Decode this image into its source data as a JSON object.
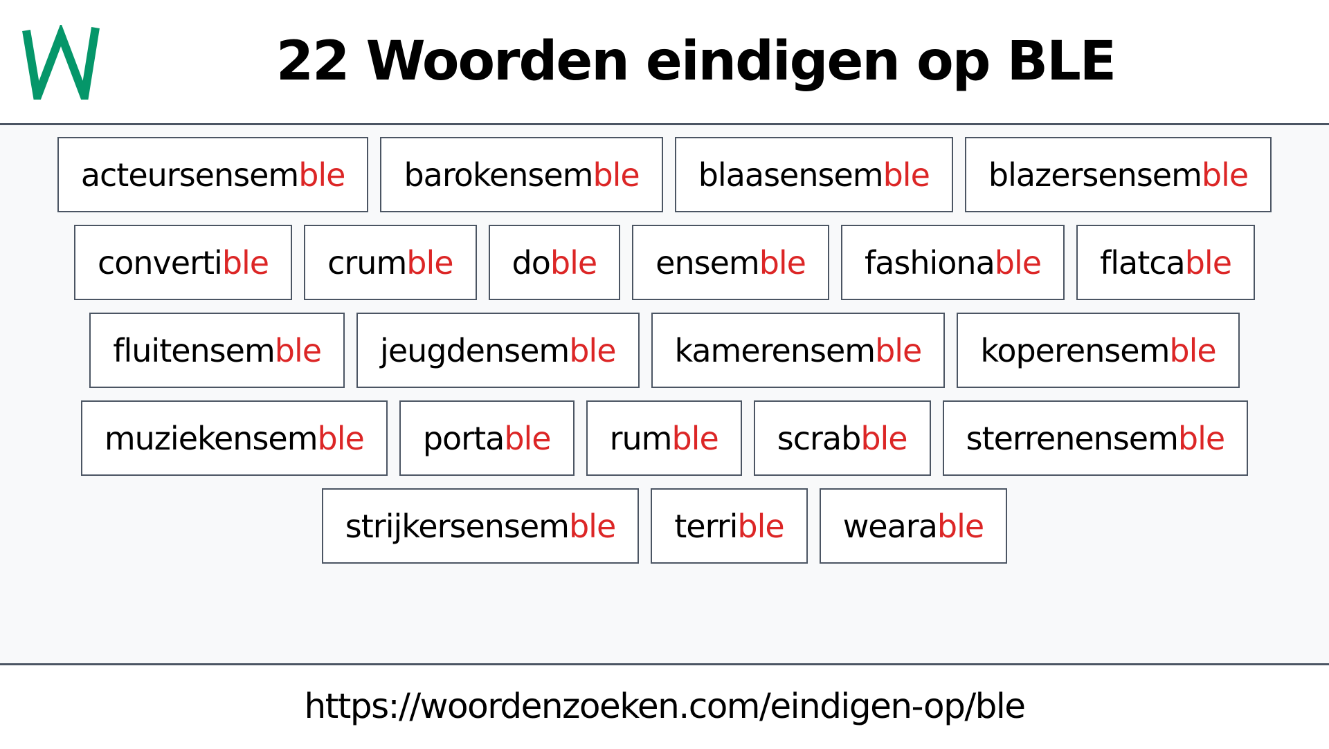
{
  "header": {
    "logo_letter": "W",
    "logo_color": "#059669",
    "title": "22 Woorden eindigen op BLE"
  },
  "suffix_color": "#dc2626",
  "rows": [
    [
      {
        "prefix": "acteursensem",
        "suffix": "ble"
      },
      {
        "prefix": "barokensem",
        "suffix": "ble"
      },
      {
        "prefix": "blaasensem",
        "suffix": "ble"
      },
      {
        "prefix": "blazersensem",
        "suffix": "ble"
      }
    ],
    [
      {
        "prefix": "converti",
        "suffix": "ble"
      },
      {
        "prefix": "crum",
        "suffix": "ble"
      },
      {
        "prefix": "do",
        "suffix": "ble"
      },
      {
        "prefix": "ensem",
        "suffix": "ble"
      },
      {
        "prefix": "fashiona",
        "suffix": "ble"
      },
      {
        "prefix": "flatca",
        "suffix": "ble"
      }
    ],
    [
      {
        "prefix": "fluitensem",
        "suffix": "ble"
      },
      {
        "prefix": "jeugdensem",
        "suffix": "ble"
      },
      {
        "prefix": "kamerensem",
        "suffix": "ble"
      },
      {
        "prefix": "koperensem",
        "suffix": "ble"
      }
    ],
    [
      {
        "prefix": "muziekensem",
        "suffix": "ble"
      },
      {
        "prefix": "porta",
        "suffix": "ble"
      },
      {
        "prefix": "rum",
        "suffix": "ble"
      },
      {
        "prefix": "scrab",
        "suffix": "ble"
      },
      {
        "prefix": "sterrenensem",
        "suffix": "ble"
      }
    ],
    [
      {
        "prefix": "strijkersensem",
        "suffix": "ble"
      },
      {
        "prefix": "terri",
        "suffix": "ble"
      },
      {
        "prefix": "weara",
        "suffix": "ble"
      }
    ]
  ],
  "footer": {
    "url": "https://woordenzoeken.com/eindigen-op/ble"
  }
}
